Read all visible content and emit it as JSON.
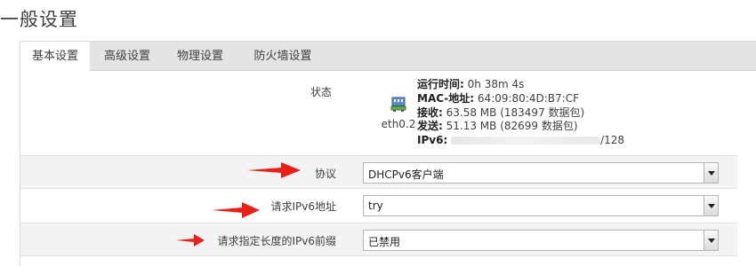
{
  "page": {
    "title": "一般设置"
  },
  "tabs": [
    {
      "label": "基本设置",
      "active": true
    },
    {
      "label": "高级设置",
      "active": false
    },
    {
      "label": "物理设置",
      "active": false
    },
    {
      "label": "防火墙设置",
      "active": false
    }
  ],
  "status": {
    "label": "状态",
    "interface_name": "eth0.2",
    "interface_icon": "network-port-icon",
    "lines": {
      "uptime_label": "运行时间:",
      "uptime_value": "0h 38m 4s",
      "mac_label": "MAC-地址:",
      "mac_value": "64:09:80:4D:B7:CF",
      "rx_label": "接收:",
      "rx_value": "63.58 MB (183497 数据包)",
      "tx_label": "发送:",
      "tx_value": "51.13 MB (82699 数据包)",
      "ipv6_label": "IPv6:",
      "ipv6_suffix": "/128"
    }
  },
  "fields": {
    "protocol": {
      "label": "协议",
      "value": "DHCPv6客户端"
    },
    "request_ipv6": {
      "label": "请求IPv6地址",
      "value": "try"
    },
    "prefix_length": {
      "label": "请求指定长度的IPv6前缀",
      "value": "已禁用"
    }
  },
  "annotation_color": "#e8201a"
}
